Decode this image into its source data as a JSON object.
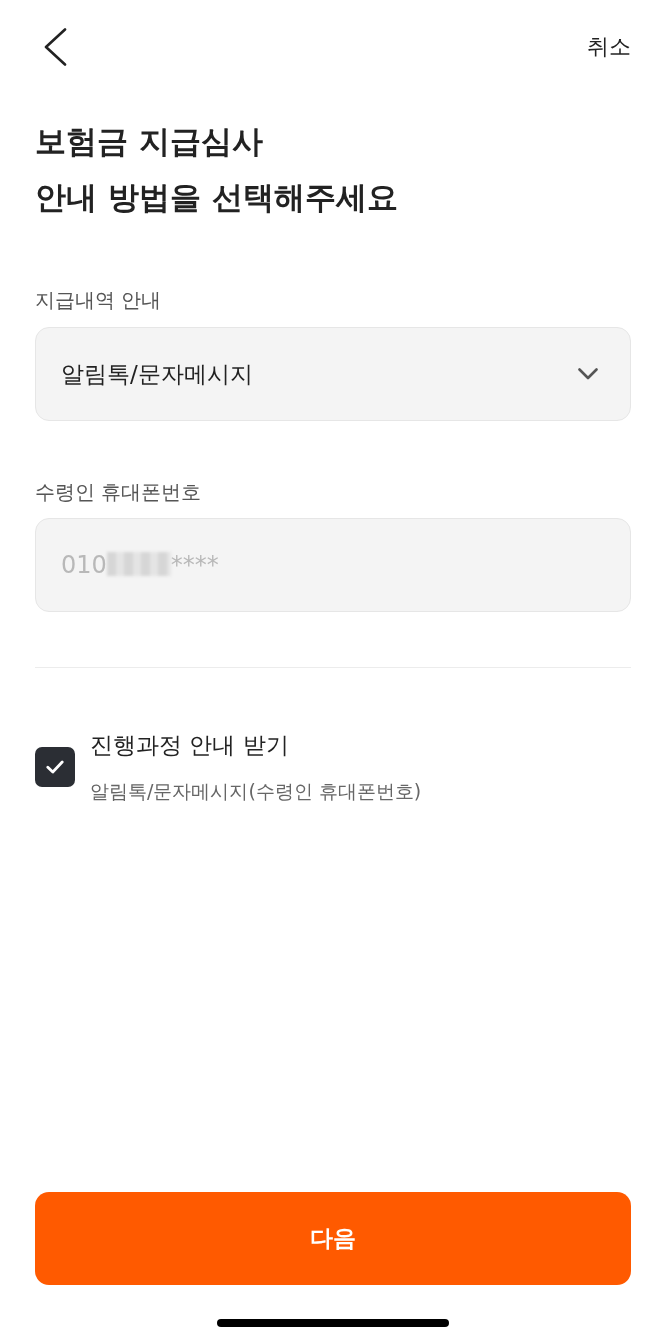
{
  "top_bar": {
    "cancel": "취소"
  },
  "title": "보험금 지급심사\n안내 방법을 선택해주세요",
  "fields": [
    {
      "kind": "select",
      "label": "지급내역 안내",
      "value": "알림톡/문자메시지"
    },
    {
      "kind": "text",
      "label": "수령인 휴대폰번호",
      "value_start": "010",
      "redacted": true,
      "value_end": "****",
      "disabled": true
    }
  ],
  "consent": {
    "label": "진행과정 안내 받기",
    "description": "알림톡/문자메시지(수령인 휴대폰번호)",
    "checked": true
  },
  "primary_button": {
    "label": "다음"
  }
}
